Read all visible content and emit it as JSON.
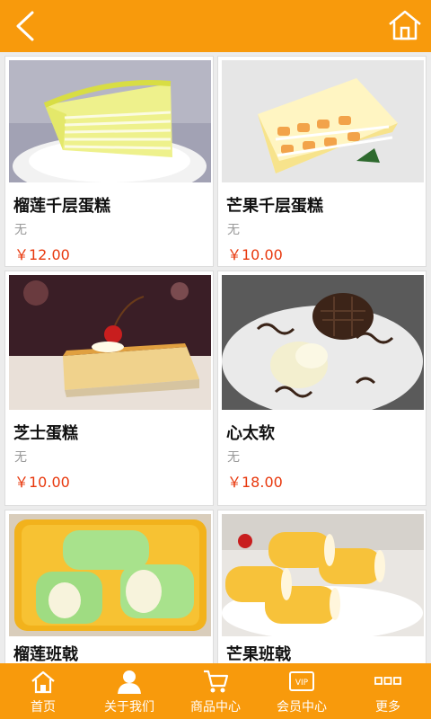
{
  "header": {
    "back_icon": "chevron-left-icon",
    "home_icon": "home-icon"
  },
  "products": [
    {
      "name": "榴莲千层蛋糕",
      "desc": "无",
      "price": "￥12.00"
    },
    {
      "name": "芒果千层蛋糕",
      "desc": "无",
      "price": "￥10.00"
    },
    {
      "name": "芝士蛋糕",
      "desc": "无",
      "price": "￥10.00"
    },
    {
      "name": "心太软",
      "desc": "无",
      "price": "￥18.00"
    },
    {
      "name": "榴莲班戟"
    },
    {
      "name": "芒果班戟"
    }
  ],
  "nav": [
    {
      "label": "首页",
      "icon": "home-icon"
    },
    {
      "label": "关于我们",
      "icon": "user-icon"
    },
    {
      "label": "商品中心",
      "icon": "cart-icon"
    },
    {
      "label": "会员中心",
      "icon": "vip-icon"
    },
    {
      "label": "更多",
      "icon": "more-icon"
    }
  ],
  "colors": {
    "accent": "#f89a0c",
    "price": "#e8380d",
    "desc": "#999999",
    "background": "#ececec"
  }
}
